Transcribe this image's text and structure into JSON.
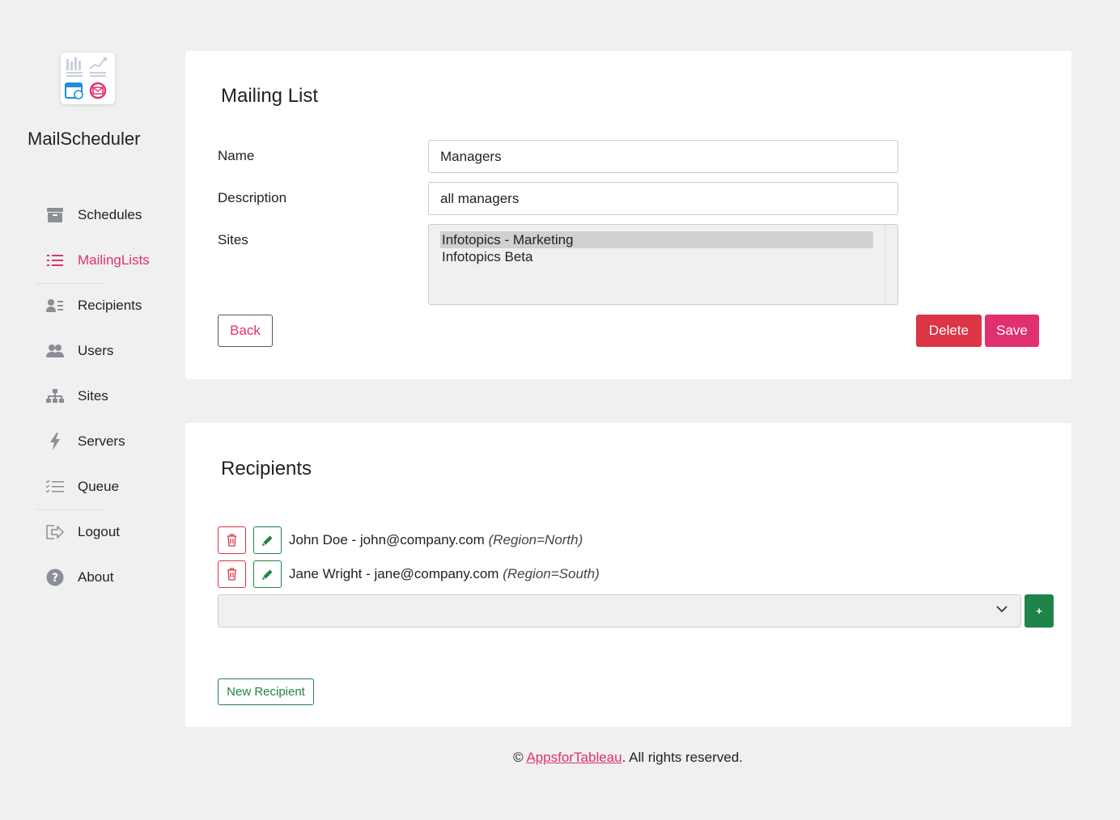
{
  "app": {
    "name": "MailScheduler"
  },
  "nav": {
    "items": [
      {
        "label": "Schedules",
        "icon": "archive-icon",
        "active": false
      },
      {
        "label": "MailingLists",
        "icon": "list-icon",
        "active": true
      },
      {
        "label": "Recipients",
        "icon": "address-card-icon",
        "active": false
      },
      {
        "label": "Users",
        "icon": "users-icon",
        "active": false
      },
      {
        "label": "Sites",
        "icon": "sitemap-icon",
        "active": false
      },
      {
        "label": "Servers",
        "icon": "bolt-icon",
        "active": false
      },
      {
        "label": "Queue",
        "icon": "tasks-icon",
        "active": false
      },
      {
        "label": "Logout",
        "icon": "sign-out-icon",
        "active": false
      },
      {
        "label": "About",
        "icon": "question-circle-icon",
        "active": false
      }
    ]
  },
  "mailing_list": {
    "title": "Mailing List",
    "name_label": "Name",
    "name_value": "Managers",
    "description_label": "Description",
    "description_value": "all managers",
    "sites_label": "Sites",
    "sites_options": [
      {
        "label": "Infotopics - Marketing",
        "selected": true
      },
      {
        "label": "Infotopics Beta",
        "selected": false
      }
    ],
    "back_label": "Back",
    "delete_label": "Delete",
    "save_label": "Save"
  },
  "recipients": {
    "title": "Recipients",
    "items": [
      {
        "name": "John Doe - john@company.com",
        "filter": "(Region=North)"
      },
      {
        "name": "Jane Wright - jane@company.com",
        "filter": "(Region=South)"
      }
    ],
    "select_value": "",
    "add_label": "+",
    "new_recipient_label": "New Recipient"
  },
  "footer": {
    "copyright": "©",
    "link_text": "AppsforTableau",
    "suffix": ". All rights reserved."
  },
  "colors": {
    "accent": "#e0306f",
    "danger": "#dc3545",
    "success": "#1e8449",
    "background": "#f0f0f0"
  }
}
